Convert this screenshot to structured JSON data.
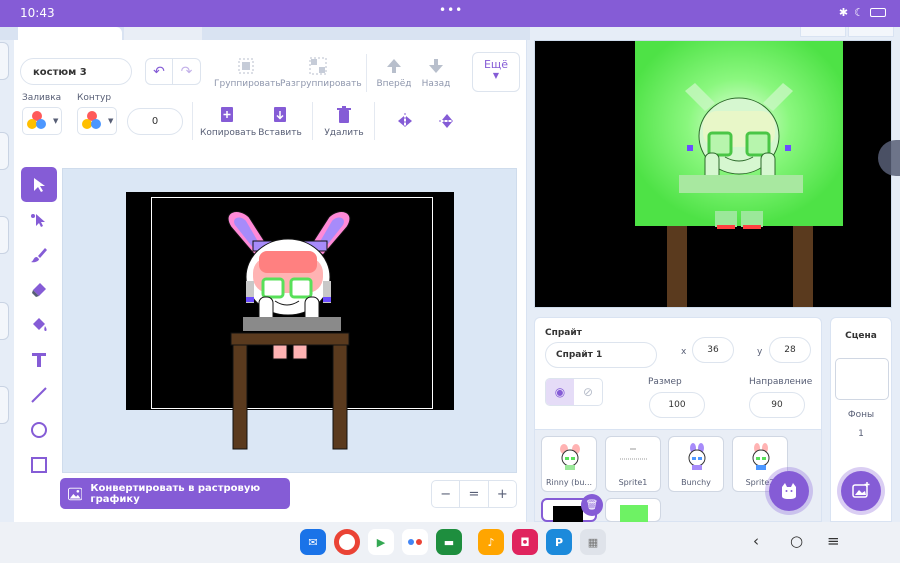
{
  "status_bar": {
    "time": "10:43",
    "dots": "•••"
  },
  "editor": {
    "costume_name": "костюм 3",
    "group_label": "Группировать",
    "ungroup_label": "Разгруппировать",
    "forward_label": "Вперёд",
    "back_label": "Назад",
    "more_label": "Ещё",
    "fill_label": "Заливка",
    "outline_label": "Контур",
    "outline_width": "0",
    "copy_label": "Копировать",
    "paste_label": "Вставить",
    "delete_label": "Удалить",
    "convert_label": "Конвертировать в растровую графику",
    "zoom_out": "−",
    "zoom_reset": "=",
    "zoom_in": "+"
  },
  "sprite_info": {
    "sprite_label": "Спрайт",
    "sprite_name": "Спрайт 1",
    "x_label": "x",
    "x_value": "36",
    "y_label": "y",
    "y_value": "28",
    "size_label": "Размер",
    "size_value": "100",
    "direction_label": "Направление",
    "direction_value": "90"
  },
  "sprites": [
    {
      "name": "Rinny (bu..."
    },
    {
      "name": "Sprite1"
    },
    {
      "name": "Bunchy"
    },
    {
      "name": "Sprite2"
    }
  ],
  "scene": {
    "title": "Сцена",
    "backdrops_label": "Фоны",
    "backdrops_count": "1"
  },
  "colors": {
    "accent": "#855cd6",
    "stage_glow": "#5cf25a"
  }
}
